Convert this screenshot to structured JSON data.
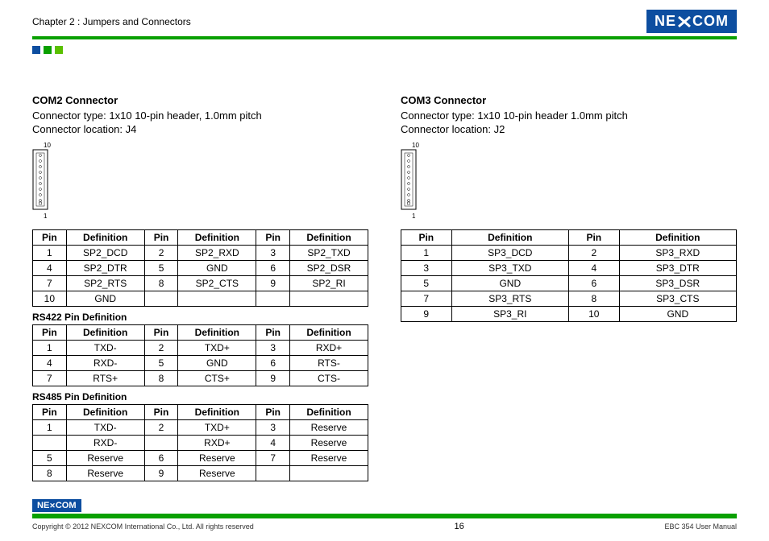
{
  "header": {
    "chapter": "Chapter 2 : Jumpers and Connectors",
    "logo_text": "NE COM"
  },
  "col1": {
    "title": "COM2 Connector",
    "type_line": "Connector type: 1x10 10-pin header, 1.0mm pitch",
    "loc_line": "Connector location: J4",
    "connector_label_top": "10",
    "connector_label_bottom": "1",
    "table1": {
      "headers": [
        "Pin",
        "Definition",
        "Pin",
        "Definition",
        "Pin",
        "Definition"
      ],
      "rows": [
        [
          "1",
          "SP2_DCD",
          "2",
          "SP2_RXD",
          "3",
          "SP2_TXD"
        ],
        [
          "4",
          "SP2_DTR",
          "5",
          "GND",
          "6",
          "SP2_DSR"
        ],
        [
          "7",
          "SP2_RTS",
          "8",
          "SP2_CTS",
          "9",
          "SP2_RI"
        ],
        [
          "10",
          "GND",
          "",
          "",
          "",
          ""
        ]
      ]
    },
    "rs422_title": "RS422 Pin Definition",
    "table2": {
      "headers": [
        "Pin",
        "Definition",
        "Pin",
        "Definition",
        "Pin",
        "Definition"
      ],
      "rows": [
        [
          "1",
          "TXD-",
          "2",
          "TXD+",
          "3",
          "RXD+"
        ],
        [
          "4",
          "RXD-",
          "5",
          "GND",
          "6",
          "RTS-"
        ],
        [
          "7",
          "RTS+",
          "8",
          "CTS+",
          "9",
          "CTS-"
        ]
      ]
    },
    "rs485_title": "RS485 Pin Definition",
    "table3": {
      "headers": [
        "Pin",
        "Definition",
        "Pin",
        "Definition",
        "Pin",
        "Definition"
      ],
      "rows": [
        [
          "1",
          "TXD-",
          "2",
          "TXD+",
          "3",
          "Reserve"
        ],
        [
          "",
          "RXD-",
          "",
          "RXD+",
          "4",
          "Reserve"
        ],
        [
          "5",
          "Reserve",
          "6",
          "Reserve",
          "7",
          "Reserve"
        ],
        [
          "8",
          "Reserve",
          "9",
          "Reserve",
          "",
          ""
        ]
      ]
    }
  },
  "col2": {
    "title": "COM3 Connector",
    "type_line": "Connector type: 1x10 10-pin header 1.0mm pitch",
    "loc_line": "Connector location: J2",
    "connector_label_top": "10",
    "connector_label_bottom": "1",
    "table1": {
      "headers": [
        "Pin",
        "Definition",
        "Pin",
        "Definition"
      ],
      "rows": [
        [
          "1",
          "SP3_DCD",
          "2",
          "SP3_RXD"
        ],
        [
          "3",
          "SP3_TXD",
          "4",
          "SP3_DTR"
        ],
        [
          "5",
          "GND",
          "6",
          "SP3_DSR"
        ],
        [
          "7",
          "SP3_RTS",
          "8",
          "SP3_CTS"
        ],
        [
          "9",
          "SP3_RI",
          "10",
          "GND"
        ]
      ]
    }
  },
  "footer": {
    "logo_text": "NE COM",
    "copyright": "Copyright © 2012 NEXCOM International Co., Ltd. All rights reserved",
    "page": "16",
    "manual": "EBC 354 User Manual"
  }
}
